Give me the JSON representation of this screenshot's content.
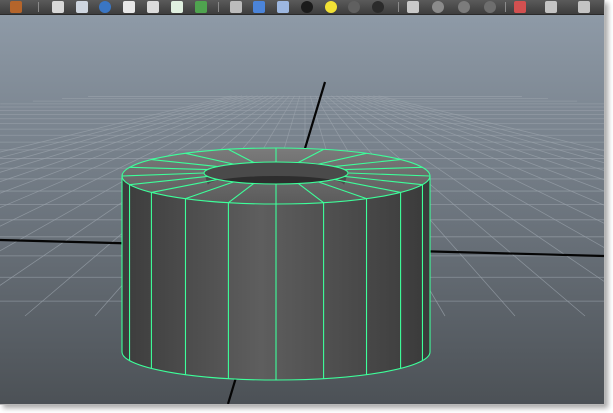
{
  "app": {
    "title": ""
  },
  "toolbar": {
    "icons": [
      "wrench-icon",
      "render-view-icon",
      "render-settings-icon",
      "hypershade-icon",
      "render-sphere-icon",
      "poly-select-icon",
      "texture-icon",
      "info-icon",
      "wireframe-shading-icon",
      "smooth-shade-icon",
      "textured-icon",
      "lighting-icon",
      "default-light-icon",
      "sphere-icon",
      "sphere-dark-icon",
      "camera-icon",
      "select-camera-icon",
      "grey-sphere-icon",
      "grey-sphere-2-icon",
      "pointer-icon",
      "panel-layout-icon"
    ]
  },
  "viewport": {
    "background_top": "#8e9aa7",
    "background_bottom": "#4c5156",
    "grid_color": "#9aa3ab",
    "axis_color": "#050505",
    "wire_color": "#3dff9a",
    "object": "pipe"
  }
}
